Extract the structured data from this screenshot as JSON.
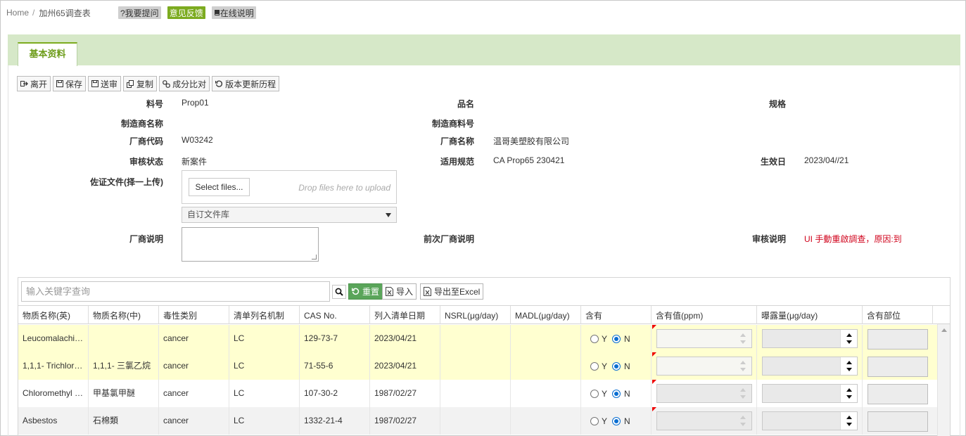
{
  "breadcrumb": {
    "home": "Home",
    "separator": "/",
    "current": "加州65调查表"
  },
  "top_buttons": [
    {
      "label": "?我要提问",
      "style": "gray"
    },
    {
      "label": "意见反馈",
      "style": "green"
    },
    {
      "label": "在线说明",
      "style": "gray",
      "icon": "book-icon"
    }
  ],
  "tab": {
    "label": "基本资料"
  },
  "toolbar": {
    "leave": "离开",
    "save": "保存",
    "submit": "送审",
    "copy": "复制",
    "compare": "成分比对",
    "history": "版本更新历程"
  },
  "form": {
    "part_no_label": "料号",
    "part_no": "Prop01",
    "product_name_label": "品名",
    "product_name": "",
    "spec_label": "规格",
    "spec": "",
    "mfr_name_label": "制造商名称",
    "mfr_name": "",
    "mfr_part_label": "制造商料号",
    "mfr_part": "",
    "vendor_code_label": "厂商代码",
    "vendor_code": "W03242",
    "vendor_name_label": "厂商名称",
    "vendor_name": "温哥美塑胶有限公司",
    "review_status_label": "审核状态",
    "review_status": "新案件",
    "standard_label": "适用规范",
    "standard": "CA Prop65 230421",
    "effective_label": "生效日",
    "effective": "2023/04//21",
    "evidence_label": "佐证文件(择一上传)",
    "select_files": "Select files...",
    "drop_hint": "Drop files here to upload",
    "library_select": "自订文件库",
    "vendor_note_label": "厂商说明",
    "vendor_note": "",
    "prev_note_label": "前次厂商说明",
    "prev_note": "",
    "review_note_label": "审核说明",
    "review_note": "UI 手動重啟調查，原因:到"
  },
  "grid": {
    "search_placeholder": "输入关键字查询",
    "reset": "重置",
    "import": "导入",
    "export": "导出至Excel",
    "columns": [
      "物质名称(英)",
      "物质名称(中)",
      "毒性类别",
      "清单列名机制",
      "CAS No.",
      "列入清单日期",
      "NSRL(μg/day)",
      "MADL(μg/day)",
      "含有",
      "含有值(ppm)",
      "曝露量(μg/day)",
      "含有部位"
    ],
    "radio_yes": "Y",
    "radio_no": "N",
    "rows": [
      {
        "en": "Leucomalachi…",
        "zh": "",
        "tox": "cancer",
        "mech": "LC",
        "cas": "129-73-7",
        "date": "2023/04/21",
        "nsrl": "",
        "madl": ""
      },
      {
        "en": "1,1,1- Trichlor…",
        "zh": "1,1,1- 三氯乙烷",
        "tox": "cancer",
        "mech": "LC",
        "cas": "71-55-6",
        "date": "2023/04/21",
        "nsrl": "",
        "madl": ""
      },
      {
        "en": "Chloromethyl …",
        "zh": "甲基氯甲醚",
        "tox": "cancer",
        "mech": "LC",
        "cas": "107-30-2",
        "date": "1987/02/27",
        "nsrl": "",
        "madl": ""
      },
      {
        "en": "Asbestos",
        "zh": "石棉類",
        "tox": "cancer",
        "mech": "LC",
        "cas": "1332-21-4",
        "date": "1987/02/27",
        "nsrl": "",
        "madl": ""
      }
    ]
  },
  "colors": {
    "accent_green": "#7cab1f",
    "tab_band": "#d6e8c8",
    "highlight_row": "#ffffd0",
    "alert_red": "#d0021b",
    "radio_blue": "#0a6ed1"
  }
}
